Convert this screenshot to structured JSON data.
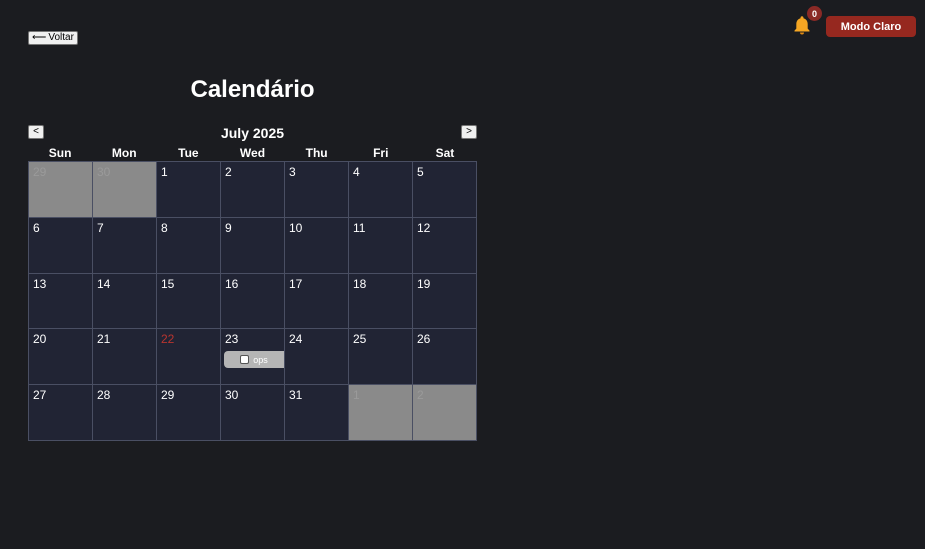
{
  "header": {
    "back_label": "Voltar",
    "back_icon": "⟵",
    "notifications_count": "0",
    "theme_toggle_label": "Modo Claro"
  },
  "page_title": "Calendário",
  "calendar": {
    "month_label": "July 2025",
    "prev_label": "<",
    "next_label": ">",
    "weekdays": [
      "Sun",
      "Mon",
      "Tue",
      "Wed",
      "Thu",
      "Fri",
      "Sat"
    ],
    "today": "22",
    "days": [
      {
        "label": "29",
        "outside": true
      },
      {
        "label": "30",
        "outside": true
      },
      {
        "label": "1"
      },
      {
        "label": "2"
      },
      {
        "label": "3"
      },
      {
        "label": "4"
      },
      {
        "label": "5"
      },
      {
        "label": "6"
      },
      {
        "label": "7"
      },
      {
        "label": "8"
      },
      {
        "label": "9"
      },
      {
        "label": "10"
      },
      {
        "label": "11"
      },
      {
        "label": "12"
      },
      {
        "label": "13"
      },
      {
        "label": "14"
      },
      {
        "label": "15"
      },
      {
        "label": "16"
      },
      {
        "label": "17"
      },
      {
        "label": "18"
      },
      {
        "label": "19"
      },
      {
        "label": "20"
      },
      {
        "label": "21"
      },
      {
        "label": "22"
      },
      {
        "label": "23",
        "events": [
          {
            "title": "ops",
            "done": false
          }
        ]
      },
      {
        "label": "24"
      },
      {
        "label": "25"
      },
      {
        "label": "26"
      },
      {
        "label": "27"
      },
      {
        "label": "28"
      },
      {
        "label": "29"
      },
      {
        "label": "30"
      },
      {
        "label": "31"
      },
      {
        "label": "1",
        "outside": true
      },
      {
        "label": "2",
        "outside": true
      }
    ]
  },
  "colors": {
    "background": "#1b1c20",
    "cell": "#212434",
    "outside_cell": "#8a8a8a",
    "accent_button": "#96281f",
    "today_text": "#b9352f",
    "bell": "#f5a623"
  },
  "icons": {
    "back": "arrow-left-icon",
    "notifications": "bell-icon",
    "event_toggle": "checkbox-icon"
  }
}
